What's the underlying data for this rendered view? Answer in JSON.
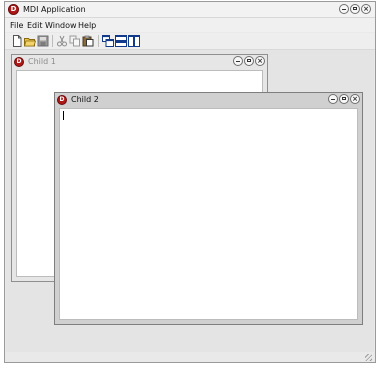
{
  "app": {
    "title": "MDI Application",
    "icon_letter": "D"
  },
  "menu": {
    "items": [
      "File",
      "Edit",
      "Window",
      "Help"
    ]
  },
  "toolbar": {
    "buttons": [
      {
        "name": "new-file-icon"
      },
      {
        "name": "open-folder-icon"
      },
      {
        "name": "save-icon"
      },
      {
        "name": "cut-icon"
      },
      {
        "name": "copy-icon"
      },
      {
        "name": "paste-icon"
      },
      {
        "name": "cascade-icon"
      },
      {
        "name": "tile-horizontal-icon"
      },
      {
        "name": "tile-vertical-icon"
      }
    ]
  },
  "children": [
    {
      "title": "Child 1",
      "active": false
    },
    {
      "title": "Child 2",
      "active": true
    }
  ],
  "colors": {
    "icon_red": "#b01818",
    "inactive_title": "#8c8c8c"
  }
}
